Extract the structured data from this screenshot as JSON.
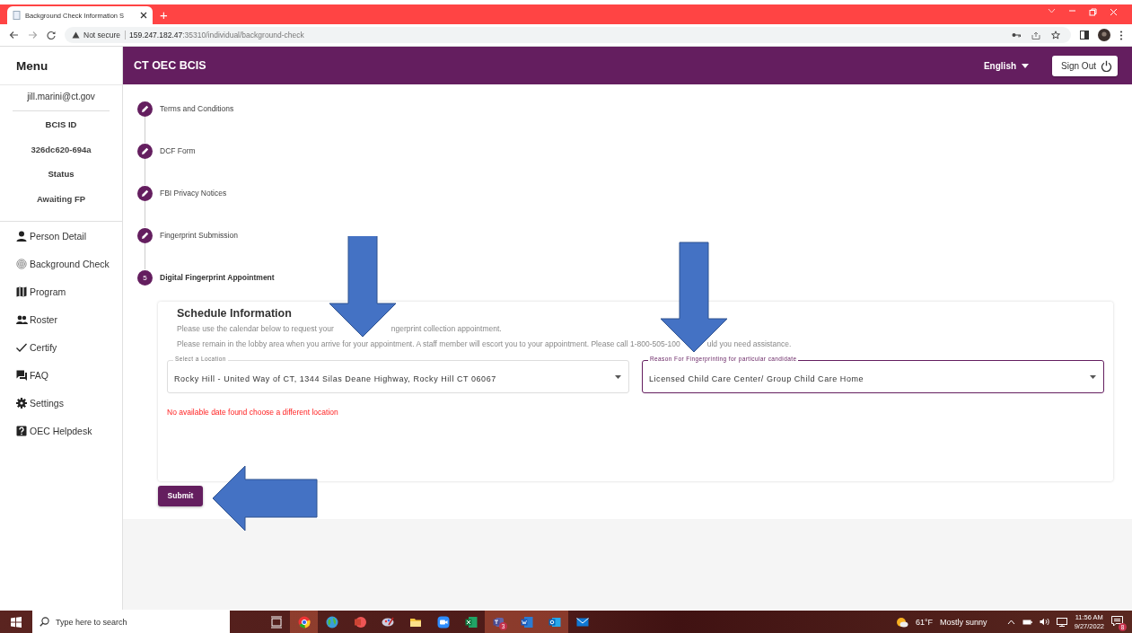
{
  "browser": {
    "tab_title": "Background Check Information S",
    "new_tab": "+",
    "security": "Not secure",
    "url_host": "159.247.182.47",
    "url_path": ":35310/individual/background-check"
  },
  "header": {
    "menu_title": "Menu",
    "app_title": "CT OEC BCIS",
    "language": "English",
    "sign_out": "Sign Out"
  },
  "sidebar": {
    "email": "jill.marini@ct.gov",
    "fields": [
      {
        "label": "BCIS ID",
        "value": "326dc620-694a"
      },
      {
        "label": "Status",
        "value": "Awaiting FP"
      }
    ],
    "items": [
      {
        "label": "Person Detail",
        "kind": "person"
      },
      {
        "label": "Background Check",
        "kind": "fingerprint"
      },
      {
        "label": "Program",
        "kind": "map"
      },
      {
        "label": "Roster",
        "kind": "group"
      },
      {
        "label": "Certify",
        "kind": "check"
      },
      {
        "label": "FAQ",
        "kind": "forum"
      },
      {
        "label": "Settings",
        "kind": "gear"
      },
      {
        "label": "OEC Helpdesk",
        "kind": "help"
      }
    ]
  },
  "steps": [
    {
      "label": "Terms and Conditions",
      "kind": "done"
    },
    {
      "label": "DCF Form",
      "kind": "done"
    },
    {
      "label": "FBI Privacy Notices",
      "kind": "done"
    },
    {
      "label": "Fingerprint Submission",
      "kind": "done"
    },
    {
      "label": "Digital Fingerprint Appointment",
      "kind": "active",
      "number": "5"
    }
  ],
  "schedule": {
    "title": "Schedule Information",
    "lines": [
      [
        "Please use the calendar below to request your",
        "ngerprint collection appointment."
      ],
      [
        "Please remain in the lobby area when you arrive for your appointment. A staff member will escort you to your appointment. Please call 1-800-505-100",
        "uld you need assistance."
      ]
    ],
    "fields": [
      {
        "label": "Select a Location",
        "value": "Rocky Hill - United Way of CT, 1344 Silas Deane Highway, Rocky Hill CT 06067",
        "focused": false
      },
      {
        "label": "Reason For Fingerprinting for particular candidate",
        "value": "Licensed Child Care Center/ Group Child Care Home",
        "focused": true
      }
    ],
    "error": "No available date found choose a different location"
  },
  "submit": "Submit",
  "arrows": [
    {
      "kind": "down"
    },
    {
      "kind": "down"
    },
    {
      "kind": "left"
    }
  ],
  "taskbar": {
    "search_placeholder": "Type here to search",
    "apps": [
      {
        "kind": "taskview",
        "active": false
      },
      {
        "kind": "chrome",
        "active": true
      },
      {
        "kind": "globe",
        "active": false
      },
      {
        "kind": "slides",
        "active": false
      },
      {
        "kind": "paint",
        "active": false
      },
      {
        "kind": "folder",
        "active": false
      },
      {
        "kind": "camera",
        "active": false
      },
      {
        "kind": "sheet",
        "active": false
      },
      {
        "kind": "teams",
        "active": true,
        "badge": "3"
      },
      {
        "kind": "doc",
        "active": true
      },
      {
        "kind": "outlook",
        "active": true
      },
      {
        "kind": "mail",
        "active": false
      }
    ],
    "temperature": "61°F",
    "weather": "Mostly sunny",
    "time": "11:56 AM",
    "date": "9/27/2022",
    "notifications": "8"
  }
}
